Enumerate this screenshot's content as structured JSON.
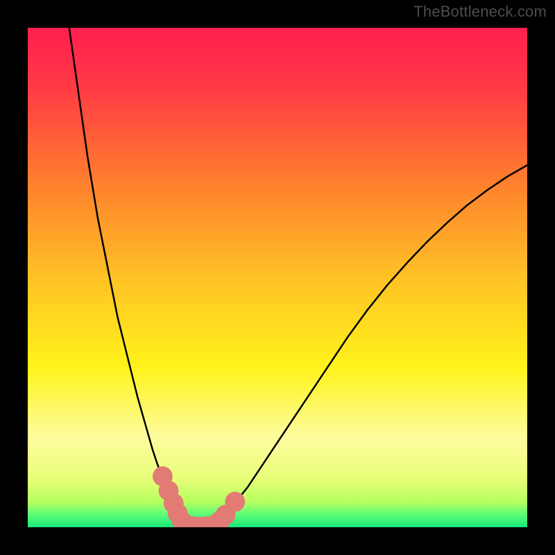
{
  "attribution": "TheBottleneck.com",
  "chart_data": {
    "type": "line",
    "title": "",
    "xlabel": "",
    "ylabel": "",
    "xlim": [
      0,
      100
    ],
    "ylim": [
      0,
      100
    ],
    "background_gradient": {
      "stops": [
        {
          "offset": 0.0,
          "color": "#ff1f4f"
        },
        {
          "offset": 0.12,
          "color": "#ff3a45"
        },
        {
          "offset": 0.3,
          "color": "#ff7c2e"
        },
        {
          "offset": 0.5,
          "color": "#ffc225"
        },
        {
          "offset": 0.68,
          "color": "#fff31a"
        },
        {
          "offset": 0.82,
          "color": "#fdfc9e"
        },
        {
          "offset": 0.9,
          "color": "#eafe7a"
        },
        {
          "offset": 0.95,
          "color": "#b6ff5e"
        },
        {
          "offset": 0.975,
          "color": "#5cfc78"
        },
        {
          "offset": 1.0,
          "color": "#17e77a"
        }
      ]
    },
    "series": [
      {
        "name": "left-curve",
        "x": [
          8.3,
          10,
          12,
          14,
          16,
          18,
          20,
          22,
          24,
          25,
          26,
          27,
          28,
          29,
          30,
          31,
          31.8
        ],
        "y": [
          100,
          88,
          74,
          62,
          52,
          42,
          34,
          26,
          19,
          15.5,
          12.5,
          10,
          7.5,
          5.2,
          3.2,
          1.5,
          0.3
        ]
      },
      {
        "name": "bottom-flat",
        "x": [
          31.8,
          33,
          34,
          35,
          36,
          37.2
        ],
        "y": [
          0.3,
          0.15,
          0.1,
          0.1,
          0.15,
          0.3
        ]
      },
      {
        "name": "right-curve",
        "x": [
          37.2,
          40,
          44,
          48,
          52,
          56,
          60,
          64,
          68,
          72,
          76,
          80,
          84,
          88,
          92,
          96,
          100
        ],
        "y": [
          0.3,
          3,
          8,
          14,
          20,
          26,
          32,
          38,
          43.5,
          48.5,
          53,
          57.2,
          61,
          64.5,
          67.5,
          70.2,
          72.5
        ]
      }
    ],
    "markers": [
      {
        "x": 27.0,
        "y": 10.2
      },
      {
        "x": 28.2,
        "y": 7.3
      },
      {
        "x": 29.2,
        "y": 4.8
      },
      {
        "x": 30.0,
        "y": 2.8
      },
      {
        "x": 30.8,
        "y": 1.3
      },
      {
        "x": 31.8,
        "y": 0.4
      },
      {
        "x": 33.0,
        "y": 0.2
      },
      {
        "x": 34.4,
        "y": 0.1
      },
      {
        "x": 35.8,
        "y": 0.2
      },
      {
        "x": 37.2,
        "y": 0.4
      },
      {
        "x": 38.4,
        "y": 1.2
      },
      {
        "x": 39.6,
        "y": 2.5
      },
      {
        "x": 41.5,
        "y": 5.1
      }
    ],
    "marker_style": {
      "radius": 2.0,
      "color": "#e17b74"
    },
    "curve_style": {
      "stroke": "#000000",
      "width": 0.35
    }
  }
}
